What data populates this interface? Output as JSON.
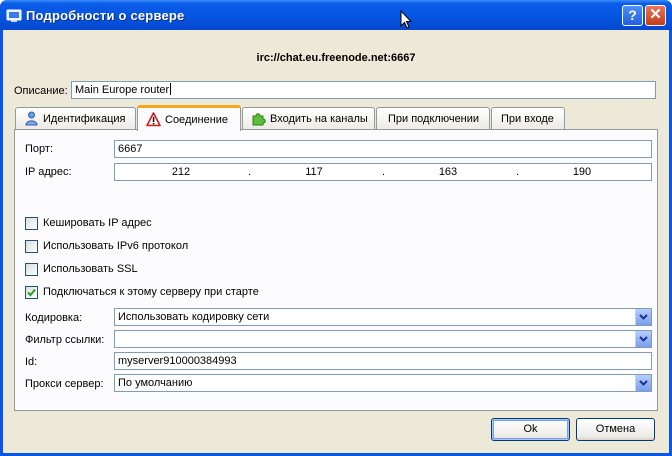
{
  "window": {
    "title": "Подробности о сервере",
    "help_label": "?",
    "close_label": "✕"
  },
  "server_url": "irc://chat.eu.freenode.net:6667",
  "description": {
    "label": "Описание:",
    "value": "Main Europe router"
  },
  "tabs": [
    {
      "label": "Идентификация",
      "icon": "person-icon",
      "active": false
    },
    {
      "label": "Соединение",
      "icon": "warning-icon",
      "active": true
    },
    {
      "label": "Входить на каналы",
      "icon": "puzzle-icon",
      "active": false
    },
    {
      "label": "При подключении",
      "icon": "",
      "active": false
    },
    {
      "label": "При входе",
      "icon": "",
      "active": false
    }
  ],
  "connection": {
    "port_label": "Порт:",
    "port_value": "6667",
    "ip_label": "IP адрес:",
    "ip_octets": [
      "212",
      "117",
      "163",
      "190"
    ],
    "checkboxes": [
      {
        "label": "Кешировать IP адрес",
        "checked": false
      },
      {
        "label": "Использовать IPv6 протокол",
        "checked": false
      },
      {
        "label": "Использовать SSL",
        "checked": false
      },
      {
        "label": "Подключаться к этому серверу при старте",
        "checked": true
      }
    ],
    "encoding_label": "Кодировка:",
    "encoding_value": "Использовать кодировку сети",
    "link_filter_label": "Фильтр ссылки:",
    "link_filter_value": "",
    "id_label": "Id:",
    "id_value": "myserver910000384993",
    "proxy_label": "Прокси сервер:",
    "proxy_value": "По умолчанию"
  },
  "buttons": {
    "ok_label": "Ok",
    "cancel_label": "Отмена"
  },
  "colors": {
    "titlebar": "#0654e0",
    "dialog_bg": "#ece9d8",
    "active_tab_accent": "#f6a71f",
    "input_border": "#7f9db9"
  }
}
